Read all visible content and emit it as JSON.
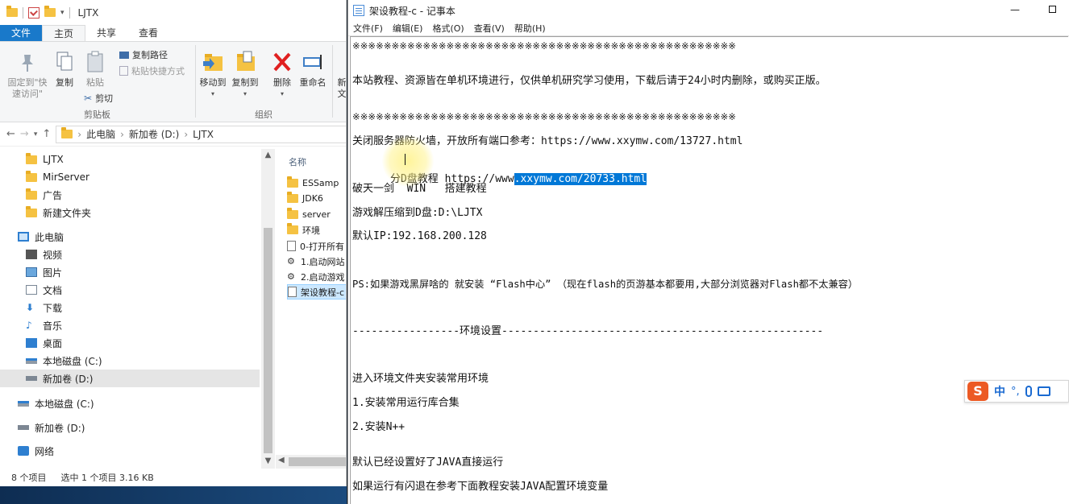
{
  "explorer": {
    "title": "LJTX",
    "tabs": [
      "文件",
      "主页",
      "共享",
      "查看"
    ],
    "ribbon": {
      "pin_label": "固定到\"快\n速访问\"",
      "copy_label": "复制",
      "paste_label": "粘贴",
      "copy_path_label": "复制路径",
      "paste_shortcut_label": "粘贴快捷方式",
      "cut_label": "剪切",
      "clipboard_group": "剪贴板",
      "move_to_label": "移动到",
      "copy_to_label": "复制到",
      "delete_label": "删除",
      "rename_label": "重命名",
      "new_label_partial": "新\n文",
      "organize_group": "组织"
    },
    "address": {
      "segments": [
        "此电脑",
        "新加卷 (D:)",
        "LJTX"
      ]
    },
    "nav": [
      {
        "label": "LJTX",
        "icon": "folder-icon"
      },
      {
        "label": "MirServer",
        "icon": "folder-icon"
      },
      {
        "label": "广告",
        "icon": "folder-icon"
      },
      {
        "label": "新建文件夹",
        "icon": "folder-icon"
      },
      {
        "label": "此电脑",
        "icon": "computer-icon"
      },
      {
        "label": "视频",
        "icon": "video-icon"
      },
      {
        "label": "图片",
        "icon": "pictures-icon"
      },
      {
        "label": "文档",
        "icon": "documents-icon"
      },
      {
        "label": "下载",
        "icon": "download-icon"
      },
      {
        "label": "音乐",
        "icon": "music-icon"
      },
      {
        "label": "桌面",
        "icon": "desktop-icon"
      },
      {
        "label": "本地磁盘 (C:)",
        "icon": "drive-icon"
      },
      {
        "label": "新加卷 (D:)",
        "icon": "drive-icon"
      },
      {
        "label": "本地磁盘 (C:)",
        "icon": "drive-icon"
      },
      {
        "label": "新加卷 (D:)",
        "icon": "drive-icon"
      },
      {
        "label": "网络",
        "icon": "network-icon"
      }
    ],
    "column_header": "名称",
    "files": [
      {
        "name": "ESSamp",
        "icon": "folder-icon"
      },
      {
        "name": "JDK6",
        "icon": "folder-icon"
      },
      {
        "name": "server",
        "icon": "folder-icon"
      },
      {
        "name": "环境",
        "icon": "folder-icon"
      },
      {
        "name": "0-打开所有",
        "icon": "file-icon"
      },
      {
        "name": "1.启动网站",
        "icon": "shortcut-icon"
      },
      {
        "name": "2.启动游戏",
        "icon": "shortcut-icon"
      },
      {
        "name": "架设教程-c",
        "icon": "text-file-icon"
      }
    ],
    "status": {
      "count": "8 个项目",
      "selection": "选中 1 个项目  3.16 KB"
    }
  },
  "notepad": {
    "title": "架设教程-c - 记事本",
    "menu": [
      "文件(F)",
      "编辑(E)",
      "格式(O)",
      "查看(V)",
      "帮助(H)"
    ],
    "lines": [
      "※※※※※※※※※※※※※※※※※※※※※※※※※※※※※※※※※※※※※※※※※※※※※※※※※",
      "本站教程、资源皆在单机环境进行，仅供单机研究学习使用，下载后请于24小时内删除，或购买正版。",
      "※※※※※※※※※※※※※※※※※※※※※※※※※※※※※※※※※※※※※※※※※※※※※※※※※",
      "关闭服务器防火墙，开放所有端口参考：https://www.xxymw.com/13727.html",
      "破天一剑  WIN   搭建教程",
      "游戏解压缩到D盘:D:\\LJTX",
      "默认IP:192.168.200.128",
      "PS:如果游戏黑屏啥的 就安装 “Flash中心” （现在flash的页游基本都要用,大部分浏览器对Flash都不太兼容）",
      "-----------------环境设置---------------------------------------------------",
      "进入环境文件夹安装常用环境",
      "1.安装常用运行库合集",
      "2.安装N++",
      "默认已经设置好了JAVA直接运行",
      "如果运行有闪退在参考下面教程安装JAVA配置环境变量"
    ],
    "line_partial": {
      "before": "分D盘教程 https://www",
      "selected": ".xxymw.com/20733.html"
    }
  },
  "ime": {
    "logo": "S",
    "mode": "中",
    "punct": "°,"
  }
}
